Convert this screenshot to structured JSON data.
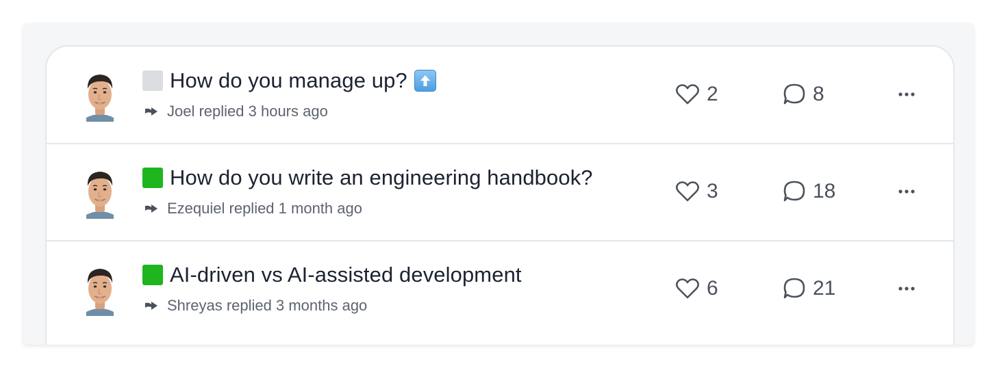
{
  "threads": [
    {
      "status_icon": "white-square-emoji",
      "status_color": "#dcdde0",
      "title": "How do you manage up?",
      "trailing_emoji": "up-arrow-emoji",
      "reply": "Joel replied 3 hours ago",
      "likes": "2",
      "comments": "8"
    },
    {
      "status_icon": "green-square-emoji",
      "status_color": "#1fb51f",
      "title": "How do you write an engineering handbook?",
      "reply": "Ezequiel replied 1 month ago",
      "likes": "3",
      "comments": "18"
    },
    {
      "status_icon": "green-square-emoji",
      "status_color": "#1fb51f",
      "title": "AI-driven vs AI-assisted development",
      "reply": "Shreyas replied 3 months ago",
      "likes": "6",
      "comments": "21"
    }
  ],
  "colors": {
    "panel_background": "#f5f6f8",
    "card_border": "#e4e6ea",
    "title_text": "#1c2230",
    "meta_text": "#5d6370",
    "icon_stroke": "#4b515c"
  }
}
